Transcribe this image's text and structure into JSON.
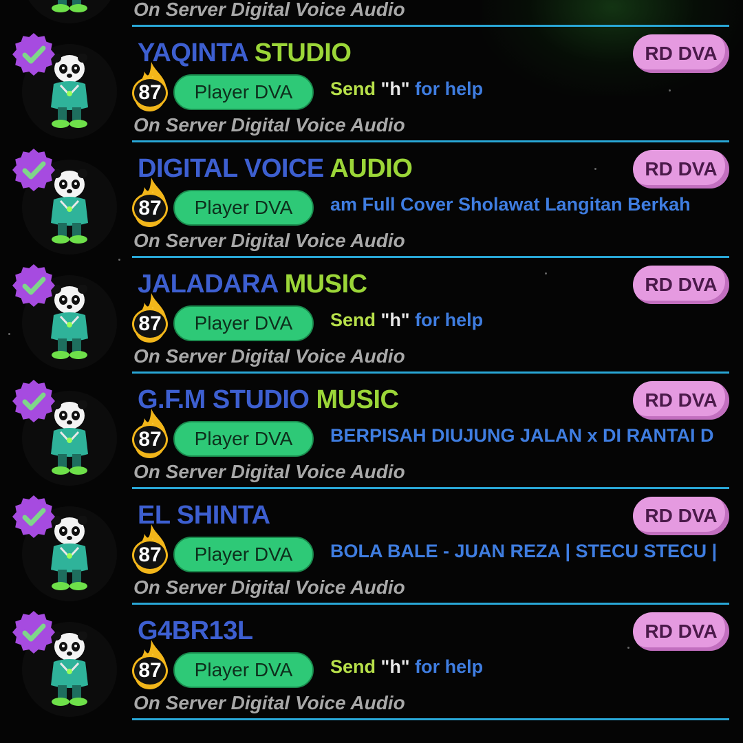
{
  "colors": {
    "background": "#050505",
    "name_part1": "#3d5fd0",
    "name_part2": "#9bd638",
    "role_badge": "#e59ae0",
    "player_badge": "#2ec977",
    "divider": "#29a7d6",
    "status_text": "#3f7de0",
    "server_text": "#a8a8a8"
  },
  "rows": [
    {
      "name_part1": "",
      "name_part2": "",
      "role": "",
      "level": "",
      "player": "",
      "status_help": "",
      "status_song": "",
      "server": "On Server Digital Voice Audio"
    },
    {
      "name_part1": "YAQINTA",
      "name_part2": "STUDIO",
      "role": "RD DVA",
      "level": "87",
      "player": "Player DVA",
      "status_help": "Send \"h\" for help",
      "status_song": "",
      "server": "On Server Digital Voice Audio"
    },
    {
      "name_part1": "DIGITAL VOICE",
      "name_part2": "AUDIO",
      "role": "RD DVA",
      "level": "87",
      "player": "Player DVA",
      "status_help": "",
      "status_song": "am Full Cover Sholawat Langitan Berkah",
      "server": "On Server Digital Voice Audio"
    },
    {
      "name_part1": "JALADARA",
      "name_part2": "MUSIC",
      "role": "RD DVA",
      "level": "87",
      "player": "Player DVA",
      "status_help": "Send \"h\" for help",
      "status_song": "",
      "server": "On Server Digital Voice Audio"
    },
    {
      "name_part1": "G.F.M STUDIO",
      "name_part2": "MUSIC",
      "role": "RD DVA",
      "level": "87",
      "player": "Player DVA",
      "status_help": "",
      "status_song": "BERPISAH DIUJUNG JALAN x DI RANTAI D",
      "server": "On Server Digital Voice Audio"
    },
    {
      "name_part1": "EL SHINTA",
      "name_part2": "",
      "role": "RD DVA",
      "level": "87",
      "player": "Player DVA",
      "status_help": "",
      "status_song": "BOLA BALE - JUAN REZA | STECU STECU |",
      "server": "On Server Digital Voice Audio"
    },
    {
      "name_part1": "G4BR13L",
      "name_part2": "",
      "role": "RD DVA",
      "level": "87",
      "player": "Player DVA",
      "status_help": "Send \"h\" for help",
      "status_song": "",
      "server": "On Server Digital Voice Audio"
    }
  ]
}
